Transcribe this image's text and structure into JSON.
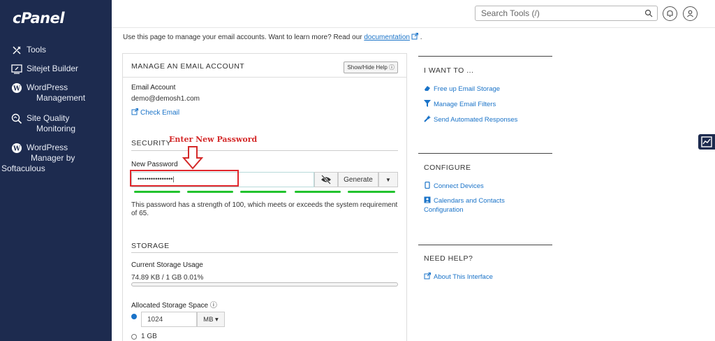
{
  "brand": {
    "logo": "cPanel"
  },
  "sidebar": {
    "items": [
      {
        "icon": "tools-icon",
        "label": "Tools"
      },
      {
        "icon": "sitejet-icon",
        "label": "Sitejet Builder"
      },
      {
        "icon": "wordpress-icon",
        "label_line1": "WordPress",
        "label_line2": "Management"
      },
      {
        "icon": "site-quality-icon",
        "label_line1": "Site Quality",
        "label_line2": "Monitoring"
      },
      {
        "icon": "wordpress-icon",
        "label_line1": "WordPress",
        "label_line2": "Manager by",
        "label_line3": "Softaculous"
      }
    ]
  },
  "header": {
    "search_placeholder": "Search Tools (/)"
  },
  "intro": {
    "text": "Use this page to manage your email accounts. Want to learn more? Read our ",
    "link": "documentation",
    "suffix": " ."
  },
  "panel": {
    "title": "MANAGE AN EMAIL ACCOUNT",
    "help_button": "Show/Hide Help ⓘ",
    "email_label": "Email Account",
    "email_value": "demo@demosh1.com",
    "check_email": "Check Email",
    "security": {
      "heading": "SECURITY",
      "new_password_label": "New Password",
      "password_value": "••••••••••••••••|",
      "generate_label": "Generate",
      "strength_text": "This password has a strength of 100, which meets or exceeds the system requirement of 65."
    },
    "storage": {
      "heading": "STORAGE",
      "current_label": "Current Storage Usage",
      "current_value": "74.89 KB / 1 GB 0.01%",
      "usage_percent": 0.01,
      "allocated_label": "Allocated Storage Space ⓘ",
      "quota_value": "1024",
      "unit": "MB ▾",
      "option_1gb": "1 GB"
    }
  },
  "annotation": {
    "text": "Enter New Password",
    "color": "#d42a2a"
  },
  "right": {
    "i_want_to": {
      "title": "I WANT TO ...",
      "items": [
        "Free up Email Storage",
        "Manage Email Filters",
        "Send Automated Responses"
      ]
    },
    "configure": {
      "title": "CONFIGURE",
      "items": [
        "Connect Devices"
      ],
      "calendars_line1": "Calendars and Contacts",
      "calendars_line2": "Configuration"
    },
    "need_help": {
      "title": "NEED HELP?",
      "items": [
        "About This Interface"
      ]
    }
  },
  "colors": {
    "sidebar_bg": "#1d2b4f",
    "link": "#1a73c8",
    "strength": "#22c32e",
    "annotation": "#e0262b"
  }
}
